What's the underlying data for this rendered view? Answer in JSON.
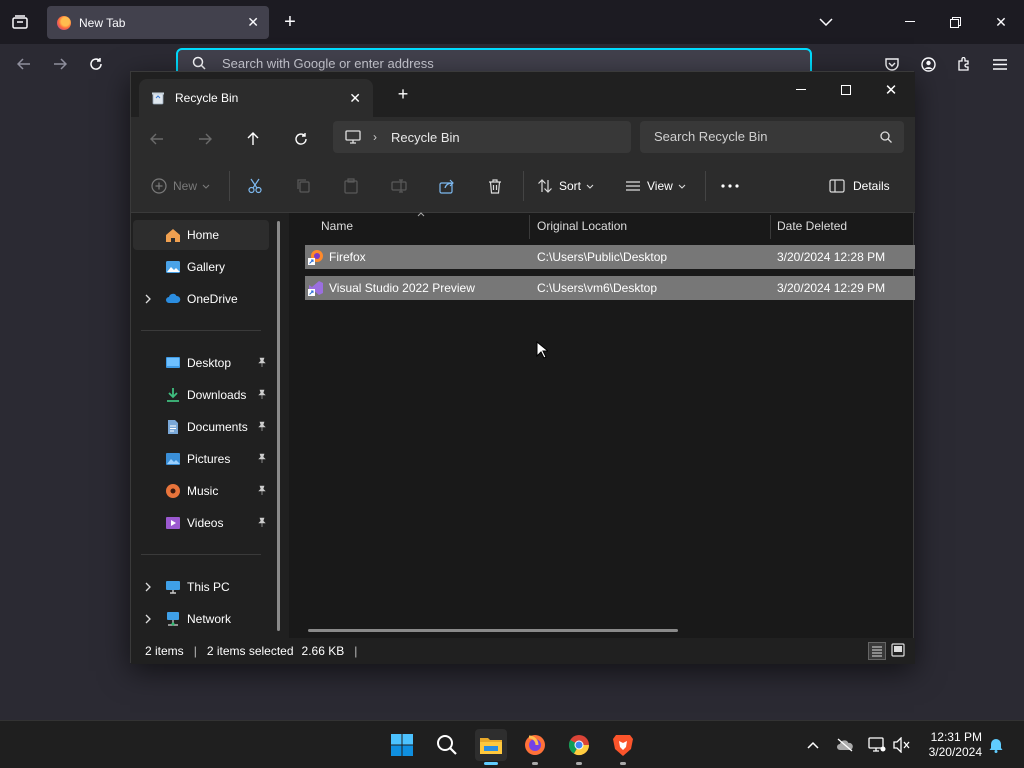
{
  "firefox": {
    "tab_title": "New Tab",
    "url_placeholder": "Search with Google or enter address"
  },
  "explorer": {
    "tab_title": "Recycle Bin",
    "breadcrumb": "Recycle Bin",
    "search_placeholder": "Search Recycle Bin",
    "toolbar": {
      "new_label": "New",
      "sort_label": "Sort",
      "view_label": "View",
      "details_label": "Details"
    },
    "nav": {
      "home": "Home",
      "gallery": "Gallery",
      "onedrive": "OneDrive",
      "desktop": "Desktop",
      "downloads": "Downloads",
      "documents": "Documents",
      "pictures": "Pictures",
      "music": "Music",
      "videos": "Videos",
      "this_pc": "This PC",
      "network": "Network"
    },
    "columns": {
      "name": "Name",
      "original_location": "Original Location",
      "date_deleted": "Date Deleted"
    },
    "files": [
      {
        "name": "Firefox",
        "location": "C:\\Users\\Public\\Desktop",
        "deleted": "3/20/2024 12:28 PM"
      },
      {
        "name": "Visual Studio 2022 Preview",
        "location": "C:\\Users\\vm6\\Desktop",
        "deleted": "3/20/2024 12:29 PM"
      }
    ],
    "status": {
      "count": "2 items",
      "selected": "2 items selected",
      "size": "2.66 KB"
    }
  },
  "taskbar": {
    "time": "12:31 PM",
    "date": "3/20/2024"
  },
  "colors": {
    "accent": "#60cdff",
    "selection": "#777777",
    "firefox_focus": "#00ddff"
  }
}
